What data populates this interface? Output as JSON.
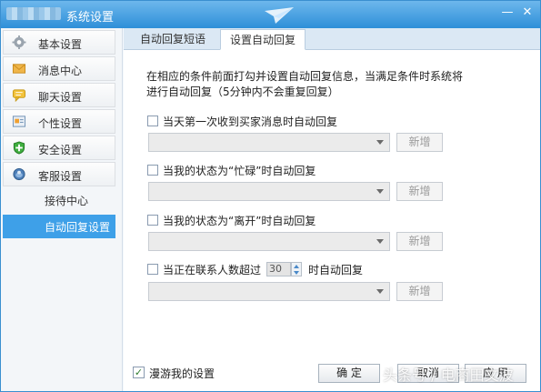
{
  "window": {
    "title": "系统设置",
    "minimize_glyph": "—",
    "close_glyph": "✕"
  },
  "sidebar": {
    "items": [
      {
        "label": "基本设置",
        "icon": "gear-icon"
      },
      {
        "label": "消息中心",
        "icon": "envelope-icon"
      },
      {
        "label": "聊天设置",
        "icon": "chat-bubble-icon"
      },
      {
        "label": "个性设置",
        "icon": "personalize-icon"
      },
      {
        "label": "安全设置",
        "icon": "shield-icon"
      },
      {
        "label": "客服设置",
        "icon": "customer-service-icon"
      }
    ],
    "subitems": [
      {
        "label": "接待中心"
      },
      {
        "label": "自动回复设置",
        "selected": true
      }
    ]
  },
  "tabs": [
    {
      "label": "自动回复短语"
    },
    {
      "label": "设置自动回复",
      "active": true
    }
  ],
  "main": {
    "description_line1": "在相应的条件前面打勾并设置自动回复信息，当满足条件时系统将",
    "description_line2": "进行自动回复（5分钟内不会重复回复）",
    "options": [
      {
        "label": "当天第一次收到买家消息时自动回复",
        "checked": false,
        "add_label": "新增"
      },
      {
        "label": "当我的状态为“忙碌”时自动回复",
        "checked": false,
        "add_label": "新增"
      },
      {
        "label": "当我的状态为“离开”时自动回复",
        "checked": false,
        "add_label": "新增"
      },
      {
        "label_prefix": "当正在联系人数超过",
        "count": "30",
        "label_suffix": "时自动回复",
        "checked": false,
        "add_label": "新增"
      }
    ]
  },
  "footer": {
    "roam_label": "漫游我的设置",
    "roam_checked": true,
    "roam_check_glyph": "✓",
    "ok_label": "确 定",
    "cancel_label": "取消",
    "apply_label": "应 用"
  },
  "watermark": "头条号 / 电商田文波",
  "colors": {
    "titlebar": "#2e8fd8",
    "selected": "#3ea0e8"
  }
}
